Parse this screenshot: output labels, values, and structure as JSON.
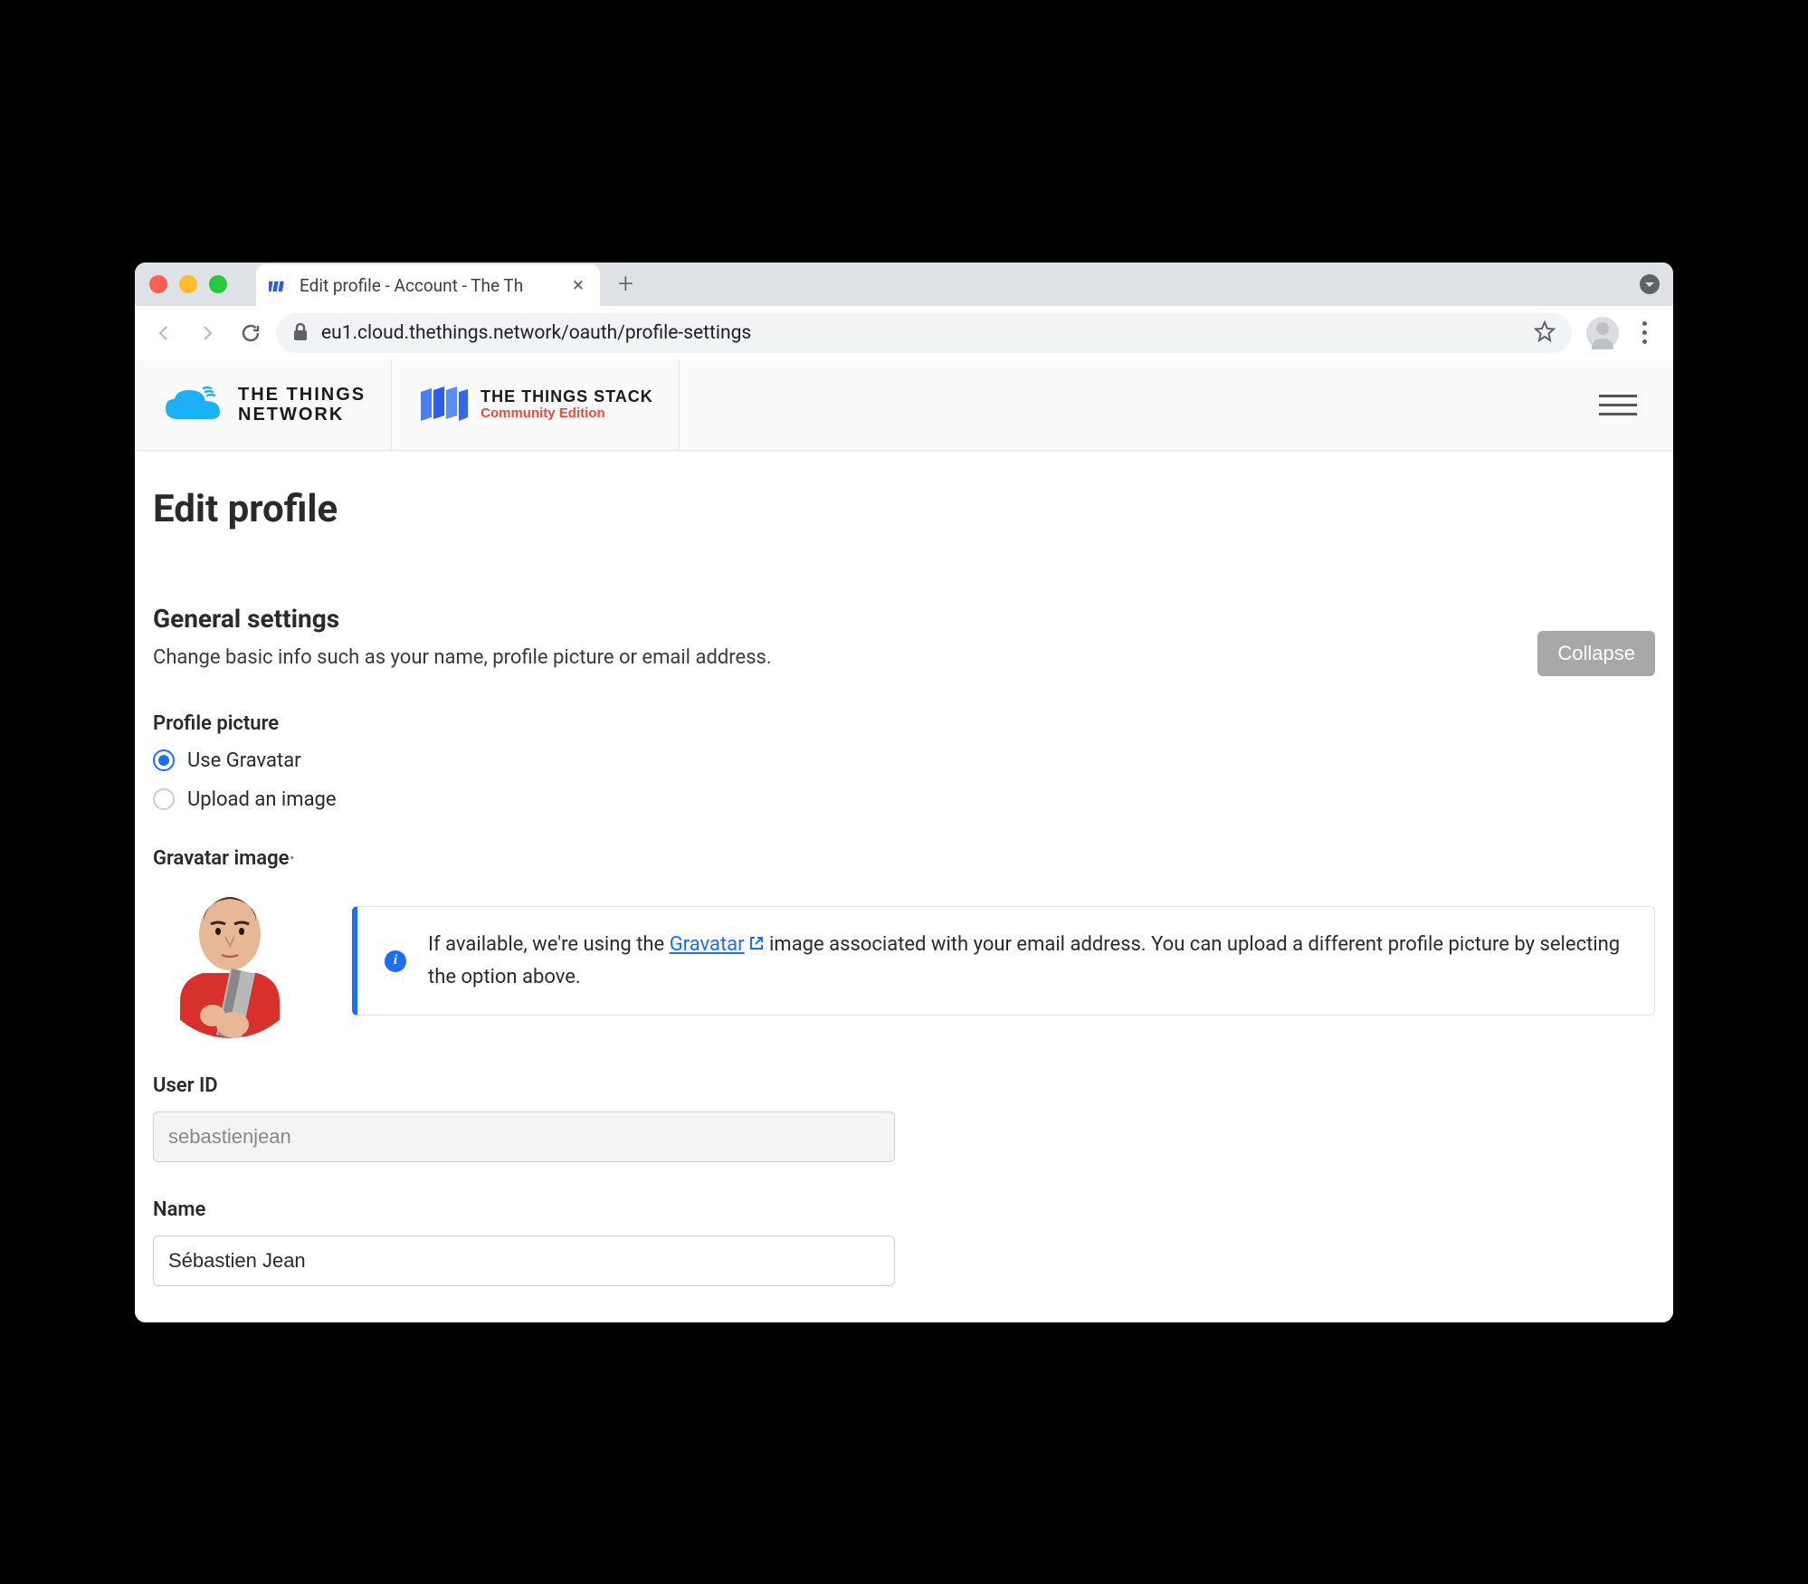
{
  "browser": {
    "tab_title": "Edit profile - Account - The Th",
    "url": "eu1.cloud.thethings.network/oauth/profile-settings"
  },
  "header": {
    "logo1_line1": "THE THINGS",
    "logo1_line2": "NETWORK",
    "logo2_main": "THE THINGS STACK",
    "logo2_sub": "Community Edition"
  },
  "page": {
    "title": "Edit profile",
    "section_title": "General settings",
    "section_desc": "Change basic info such as your name, profile picture or email address.",
    "collapse_label": "Collapse",
    "profile_picture_label": "Profile picture",
    "radio_gravatar": "Use Gravatar",
    "radio_upload": "Upload an image",
    "gravatar_image_label": "Gravatar image",
    "info_text_before": "If available, we're using the ",
    "info_link_text": "Gravatar",
    "info_text_after": " image associated with your email address. You can upload a different profile picture by selecting the option above.",
    "user_id_label": "User ID",
    "user_id_value": "sebastienjean",
    "name_label": "Name",
    "name_value": "Sébastien Jean"
  }
}
